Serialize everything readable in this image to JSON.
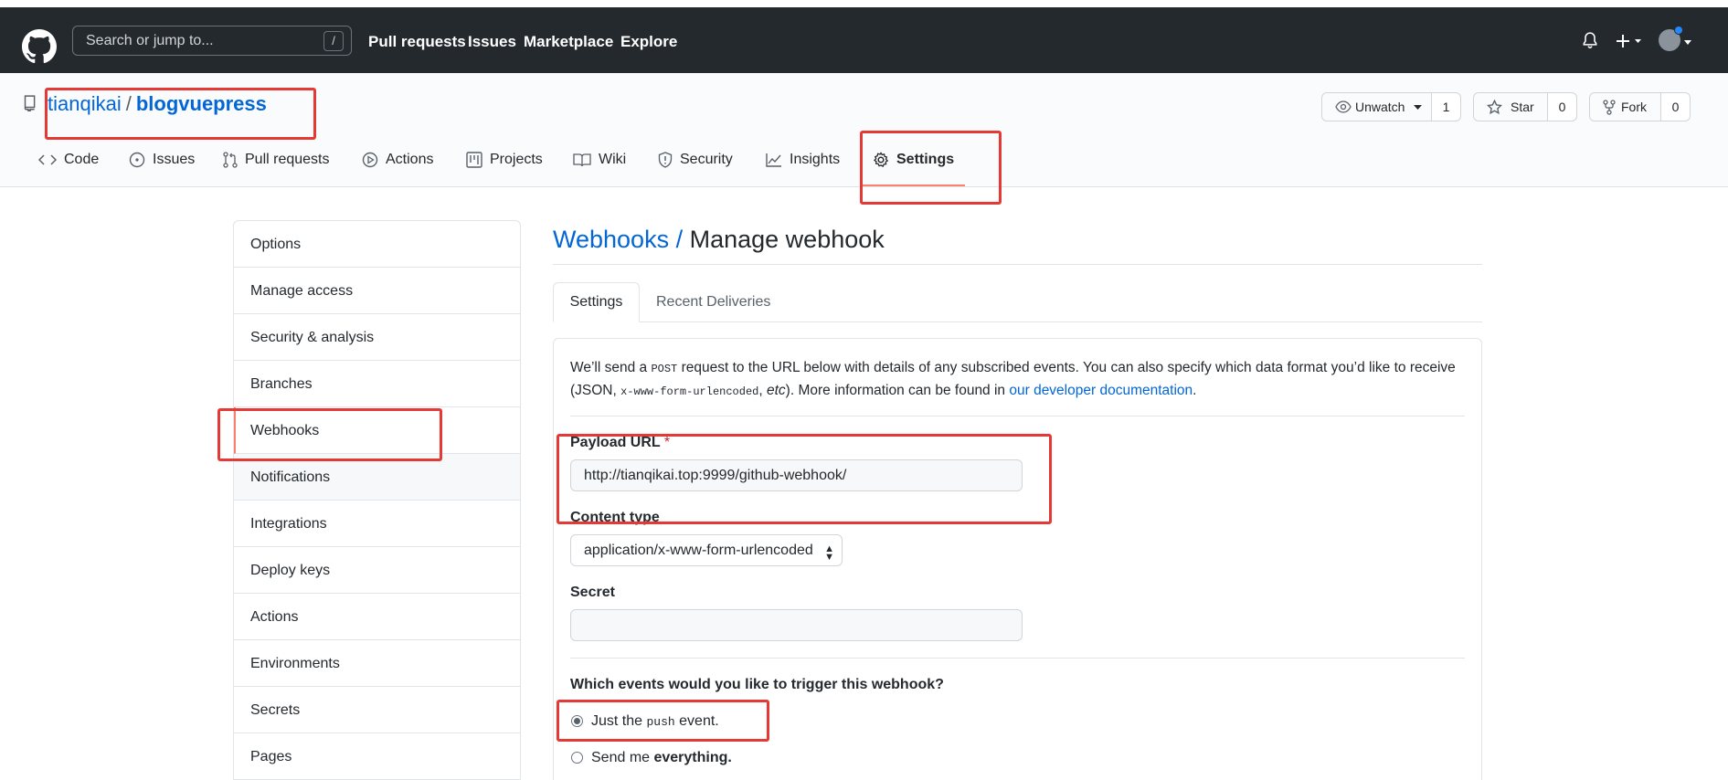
{
  "header": {
    "search_placeholder": "Search or jump to...",
    "search_shortcut": "/",
    "nav": [
      "Pull requests",
      "Issues",
      "Marketplace",
      "Explore"
    ]
  },
  "repo": {
    "owner": "tianqikai",
    "separator": "/",
    "name": "blogvuepress",
    "unwatch_label": "Unwatch",
    "unwatch_count": "1",
    "star_label": "Star",
    "star_count": "0",
    "fork_label": "Fork",
    "fork_count": "0",
    "tabs": [
      {
        "label": "Code",
        "icon": "code-icon"
      },
      {
        "label": "Issues",
        "icon": "issue-icon"
      },
      {
        "label": "Pull requests",
        "icon": "pull-request-icon"
      },
      {
        "label": "Actions",
        "icon": "play-icon"
      },
      {
        "label": "Projects",
        "icon": "project-icon"
      },
      {
        "label": "Wiki",
        "icon": "book-icon"
      },
      {
        "label": "Security",
        "icon": "shield-icon"
      },
      {
        "label": "Insights",
        "icon": "graph-icon"
      },
      {
        "label": "Settings",
        "icon": "gear-icon",
        "active": true
      }
    ]
  },
  "sidebar": {
    "items": [
      "Options",
      "Manage access",
      "Security & analysis",
      "Branches",
      "Webhooks",
      "Notifications",
      "Integrations",
      "Deploy keys",
      "Actions",
      "Environments",
      "Secrets",
      "Pages"
    ],
    "selected": "Webhooks"
  },
  "main": {
    "title_crumb": "Webhooks /",
    "title": "Manage webhook",
    "subtabs": [
      "Settings",
      "Recent Deliveries"
    ],
    "intro": {
      "part1": "We’ll send a ",
      "code1": "POST",
      "part2": " request to the URL below with details of any subscribed events. You can also specify which data format you’d like to receive (JSON, ",
      "code2": "x-www-form-urlencoded",
      "part3": ", ",
      "etc": "etc",
      "part4": "). More information can be found in ",
      "link": "our developer documentation",
      "part5": "."
    },
    "payload_label": "Payload URL",
    "required_mark": "*",
    "payload_value": "http://tianqikai.top:9999/github-webhook/",
    "content_type_label": "Content type",
    "content_type_value": "application/x-www-form-urlencoded",
    "secret_label": "Secret",
    "secret_value": "",
    "events_question": "Which events would you like to trigger this webhook?",
    "radio_push_pre": "Just the ",
    "radio_push_code": "push",
    "radio_push_post": " event.",
    "radio_all_pre": "Send me ",
    "radio_all_bold": "everything."
  },
  "colors": {
    "accent": "#0366d6",
    "header_bg": "#24292e",
    "annotation": "#e53935",
    "tab_underline": "#f9826c"
  }
}
